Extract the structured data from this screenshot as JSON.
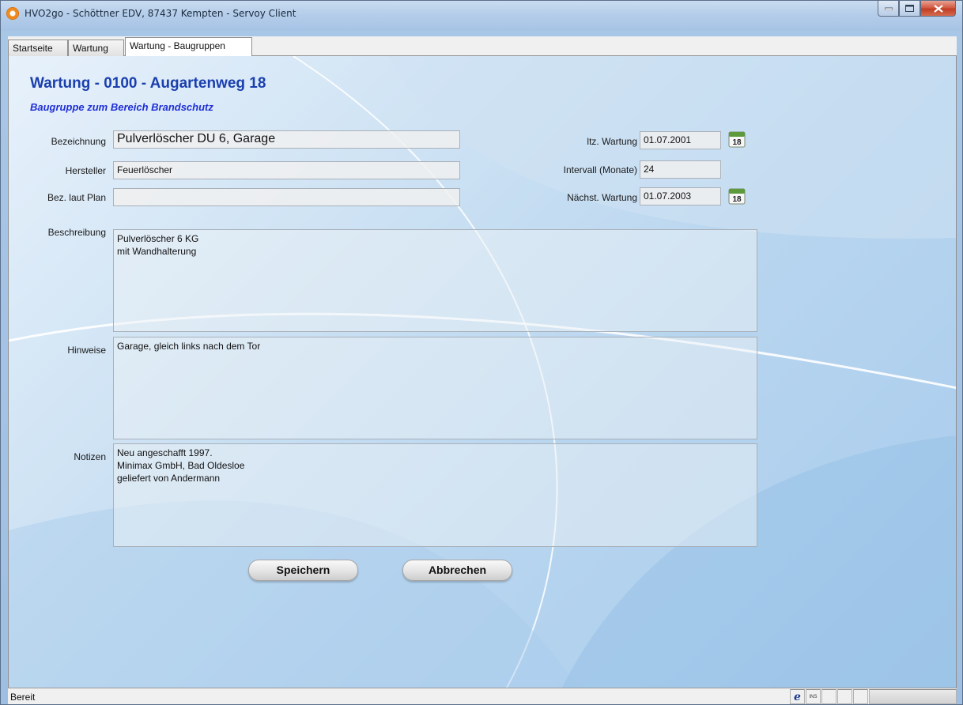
{
  "window": {
    "title": "HVO2go - Schöttner EDV, 87437 Kempten  - Servoy Client",
    "controls": {
      "minimize": "–",
      "maximize": "□",
      "close": "x"
    }
  },
  "tabs": [
    {
      "label": "Startseite"
    },
    {
      "label": "Wartung"
    },
    {
      "label": "Wartung - Baugruppen",
      "active": true
    }
  ],
  "form": {
    "title": "Wartung - 0100 - Augartenweg 18",
    "subtitle": "Baugruppe zum Bereich Brandschutz",
    "bezeichnung": {
      "label": "Bezeichnung",
      "value": "Pulverlöscher DU 6, Garage"
    },
    "hersteller": {
      "label": "Hersteller",
      "value": "Feuerlöscher"
    },
    "bez_laut_plan": {
      "label": "Bez. laut Plan",
      "value": ""
    },
    "letzte_wartung": {
      "label": "ltz. Wartung",
      "value": "01.07.2001"
    },
    "intervall": {
      "label": "Intervall (Monate)",
      "value": "24"
    },
    "naechste_wartung": {
      "label": "Nächst. Wartung",
      "value": "01.07.2003"
    },
    "beschreibung": {
      "label": "Beschreibung",
      "value": "Pulverlöscher 6 KG\nmit Wandhalterung"
    },
    "hinweise": {
      "label": "Hinweise",
      "value": "Garage, gleich links nach dem Tor"
    },
    "notizen": {
      "label": "Notizen",
      "value": "Neu angeschafft 1997.\nMinimax GmbH, Bad Oldesloe\ngeliefert von Andermann"
    },
    "calendar_day": "18",
    "save_label": "Speichern",
    "cancel_label": "Abbrechen"
  },
  "statusbar": {
    "text": "Bereit",
    "ie_glyph": "e",
    "ins": "INS"
  },
  "icons": {
    "app": "app-orange-circle-icon",
    "calendar": "calendar-icon"
  },
  "colors": {
    "heading": "#1a3fae",
    "subheading": "#1f2fd6"
  }
}
